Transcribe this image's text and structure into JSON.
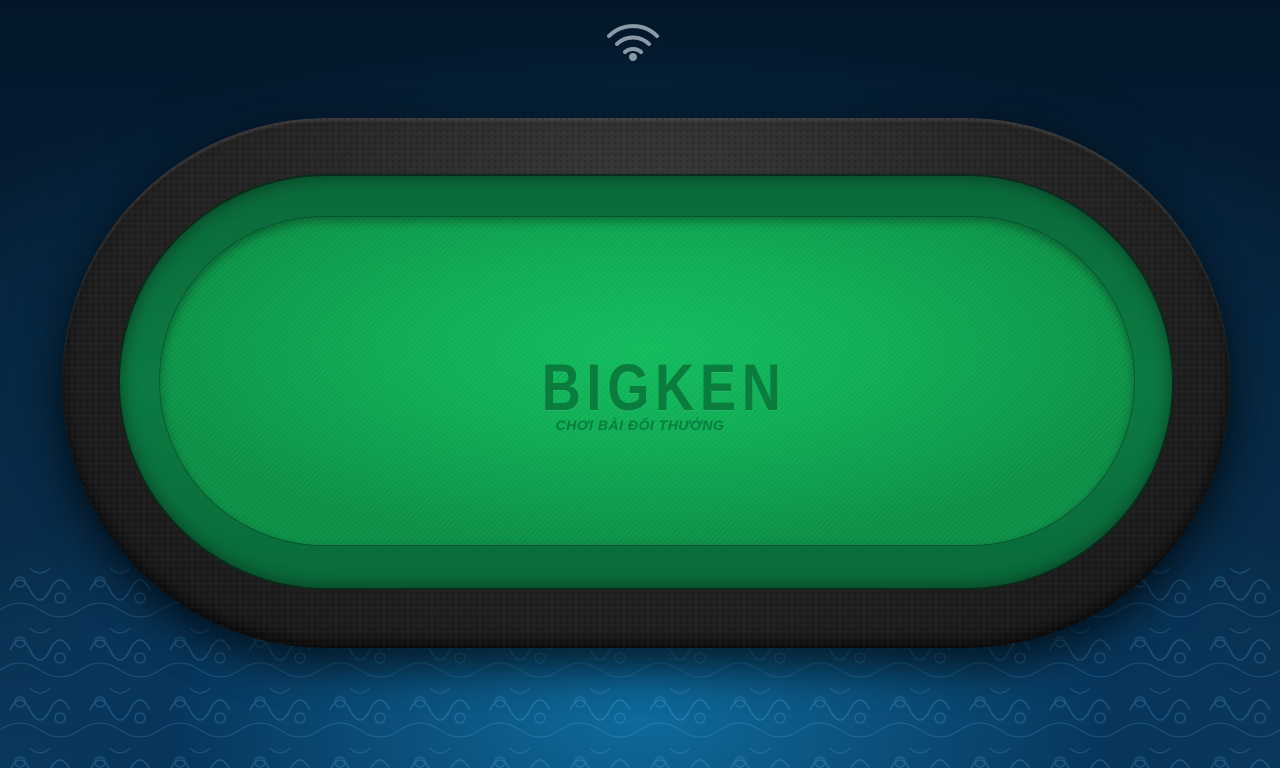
{
  "status_bar": {
    "wifi_icon": "wifi-icon"
  },
  "table": {
    "logo_title": "BIGKEN",
    "logo_subtitle": "CHƠI BÀI ĐỔI THƯỞNG",
    "felt_color": "#0fae56",
    "rail_color": "#262626"
  },
  "background": {
    "color": "#08355a"
  }
}
